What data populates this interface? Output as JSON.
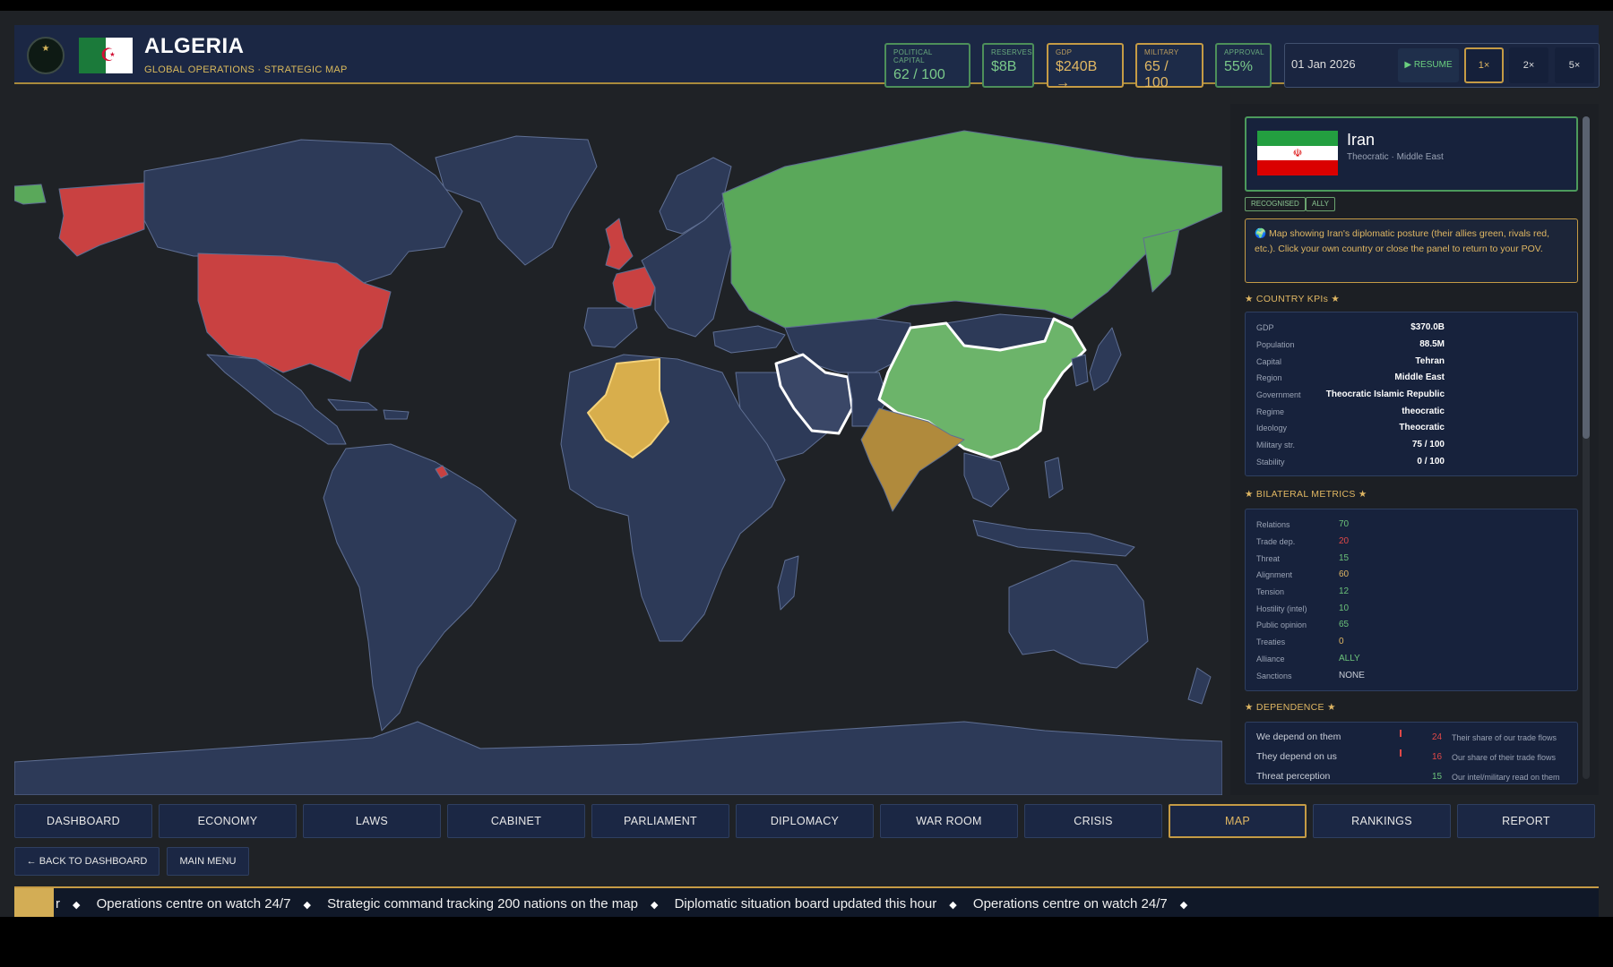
{
  "header": {
    "country_name": "ALGERIA",
    "subtitle": "GLOBAL OPERATIONS · STRATEGIC MAP",
    "stats": [
      {
        "label": "POLITICAL CAPITAL",
        "value": "62 / 100"
      },
      {
        "label": "RESERVES",
        "value": "$8B"
      },
      {
        "label": "GDP",
        "value": "$240B →"
      },
      {
        "label": "MILITARY",
        "value": "65 / 100"
      },
      {
        "label": "APPROVAL",
        "value": "55%"
      }
    ],
    "date": "01 Jan 2026",
    "resume_label": "▶ RESUME",
    "speeds": [
      "1×",
      "2×",
      "5×"
    ],
    "active_speed": "1×"
  },
  "map": {
    "colors": {
      "ocean": "#1f2226",
      "land": "#2d3a58",
      "border": "#5f6f93",
      "ally": "#5aa85a",
      "ally_light": "#6cb46a",
      "rival": "#c94141",
      "own": "#d8ae4c",
      "neutral_partner": "#b08a3c",
      "selected": "#3a4767"
    }
  },
  "panel": {
    "country": "Iran",
    "country_sub": "Theocratic · Middle East",
    "tags": [
      "RECOGNISED",
      "ALLY"
    ],
    "notice": "🌍 Map showing Iran's diplomatic posture (their allies green, rivals red, etc.). Click your own country or close the panel to return to your POV.",
    "kpi_title": "★ COUNTRY KPIs ★",
    "kpis": [
      {
        "label": "GDP",
        "value": "$370.0B"
      },
      {
        "label": "Population",
        "value": "88.5M"
      },
      {
        "label": "Capital",
        "value": "Tehran"
      },
      {
        "label": "Region",
        "value": "Middle East"
      },
      {
        "label": "Government",
        "value": "Theocratic Islamic Republic"
      },
      {
        "label": "Regime",
        "value": "theocratic"
      },
      {
        "label": "Ideology",
        "value": "Theocratic"
      },
      {
        "label": "Military str.",
        "value": "75 / 100"
      },
      {
        "label": "Stability",
        "value": "0 / 100"
      }
    ],
    "bilateral_title": "★ BILATERAL METRICS ★",
    "bilateral": [
      {
        "label": "Relations",
        "value": "70",
        "color": "#6cc37a"
      },
      {
        "label": "Trade dep.",
        "value": "20",
        "color": "#e04848"
      },
      {
        "label": "Threat",
        "value": "15",
        "color": "#6cc37a"
      },
      {
        "label": "Alignment",
        "value": "60",
        "color": "#e0b763"
      },
      {
        "label": "Tension",
        "value": "12",
        "color": "#6cc37a"
      },
      {
        "label": "Hostility (intel)",
        "value": "10",
        "color": "#6cc37a"
      },
      {
        "label": "Public opinion",
        "value": "65",
        "color": "#6cc37a"
      },
      {
        "label": "Treaties",
        "value": "0",
        "color": "#e0b763"
      },
      {
        "label": "Alliance",
        "value": "ALLY",
        "color": "#6cc37a"
      },
      {
        "label": "Sanctions",
        "value": "NONE",
        "color": "#c9ced8"
      }
    ],
    "dependence_title": "★ DEPENDENCE ★",
    "dependence": [
      {
        "label": "We depend on them",
        "value": "24",
        "color": "#e04848",
        "desc": "Their share of our trade flows"
      },
      {
        "label": "They depend on us",
        "value": "16",
        "color": "#e04848",
        "desc": "Our share of their trade flows"
      },
      {
        "label": "Threat perception",
        "value": "15",
        "color": "#6cc37a",
        "desc": "Our intel/military read on them"
      }
    ]
  },
  "nav": {
    "tabs": [
      "DASHBOARD",
      "ECONOMY",
      "LAWS",
      "CABINET",
      "PARLIAMENT",
      "DIPLOMACY",
      "WAR ROOM",
      "CRISIS",
      "MAP",
      "RANKINGS",
      "REPORT"
    ],
    "active": "MAP",
    "back_label": "← BACK TO DASHBOARD",
    "main_menu_label": "MAIN MENU"
  },
  "ticker": {
    "lead_fragment": "r",
    "items": [
      "Operations centre on watch 24/7",
      "Strategic command tracking 200 nations on the map",
      "Diplomatic situation board updated this hour",
      "Operations centre on watch 24/7"
    ]
  }
}
